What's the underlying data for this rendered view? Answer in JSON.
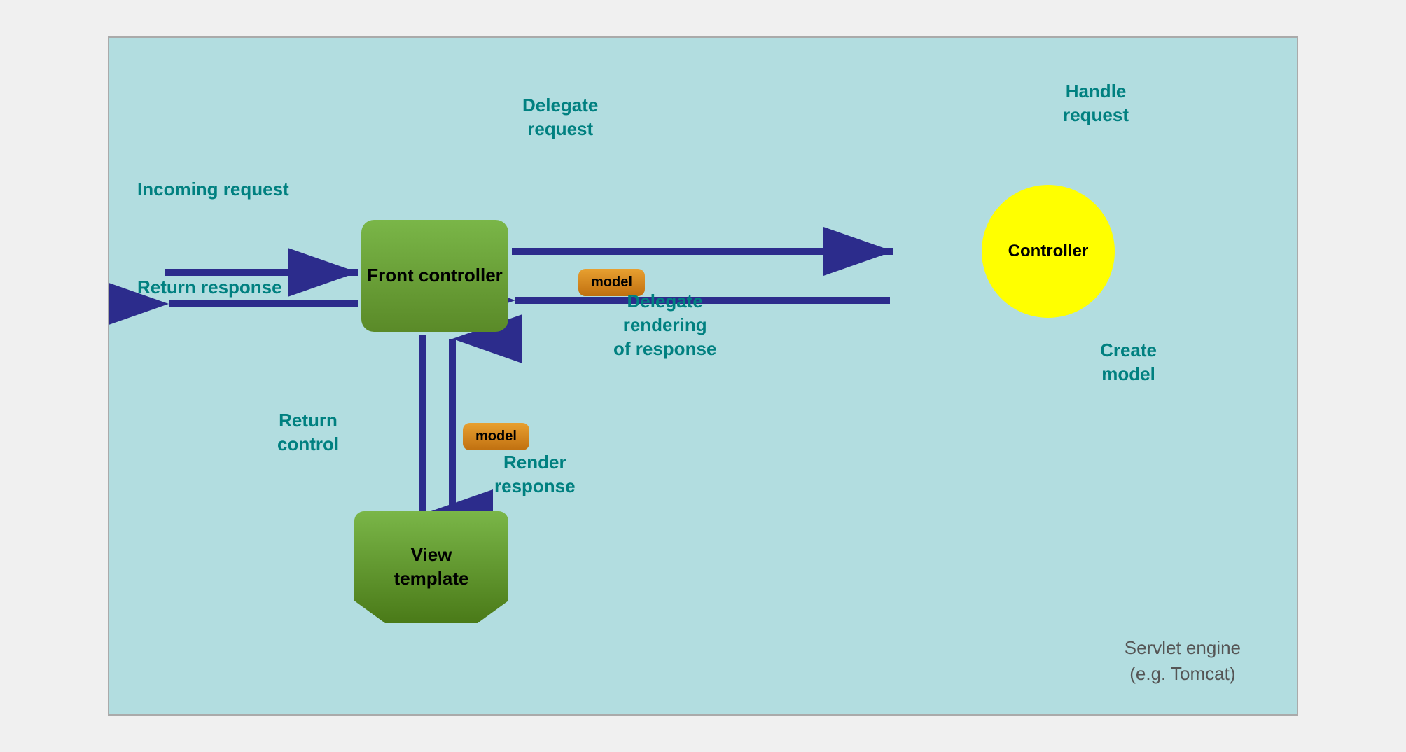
{
  "diagram": {
    "background_color": "#b2dde0",
    "servlet_label_line1": "Servlet engine",
    "servlet_label_line2": "(e.g. Tomcat)",
    "front_controller_label": "Front\ncontroller",
    "controller_label": "Controller",
    "view_template_label": "View\ntemplate",
    "model_badge_label": "model",
    "labels": {
      "incoming_request": "Incoming\nrequest",
      "return_response": "Return\nresponse",
      "delegate_request": "Delegate\nrequest",
      "handle_request": "Handle\nrequest",
      "delegate_rendering": "Delegate\nrendering\nof response",
      "create_model": "Create\nmodel",
      "return_control": "Return\ncontrol",
      "render_response": "Render\nresponse"
    },
    "arrow_color": "#2c2c8c",
    "label_color": "#008080"
  }
}
